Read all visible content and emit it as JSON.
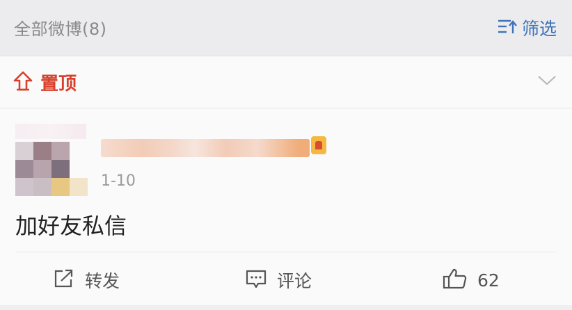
{
  "header": {
    "title": "全部微博(8)",
    "filter_label": "筛选",
    "filter_icon": "filter-icon"
  },
  "pinned": {
    "label": "置顶",
    "icon": "pin-top-icon",
    "chevron_icon": "chevron-down-icon"
  },
  "post": {
    "date": "1-10",
    "text": "加好友私信",
    "actions": {
      "repost_label": "转发",
      "comment_label": "评论",
      "like_count": "62"
    }
  },
  "colors": {
    "accent_blue": "#3f73b8",
    "pinned_red": "#d8402b"
  }
}
